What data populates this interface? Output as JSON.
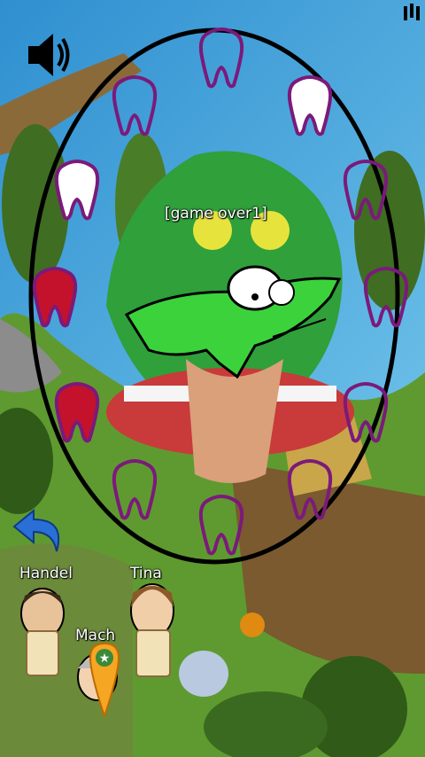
{
  "game": {
    "status_text": "[game over1]"
  },
  "players": [
    {
      "name": "Handel"
    },
    {
      "name": "Tina"
    },
    {
      "name": "Mach"
    }
  ],
  "teeth": [
    {
      "state": "empty",
      "outline": "#7b1a7b"
    },
    {
      "state": "empty",
      "outline": "#7b1a7b"
    },
    {
      "state": "white",
      "outline": "#7b1a7b"
    },
    {
      "state": "white",
      "outline": "#7b1a7b"
    },
    {
      "state": "empty",
      "outline": "#7b1a7b"
    },
    {
      "state": "red",
      "outline": "#7b1a7b"
    },
    {
      "state": "empty",
      "outline": "#7b1a7b"
    },
    {
      "state": "red",
      "outline": "#7b1a7b"
    },
    {
      "state": "empty",
      "outline": "#7b1a7b"
    },
    {
      "state": "empty",
      "outline": "#7b1a7b"
    },
    {
      "state": "empty",
      "outline": "#7b1a7b"
    },
    {
      "state": "empty",
      "outline": "#7b1a7b"
    }
  ],
  "colors": {
    "water": "#3f9ad0",
    "grass": "#5c8f2d",
    "field": "#8b6b3a",
    "crocodile": "#3cd23c",
    "tooth_red": "#c4122c",
    "ring": "#000000"
  },
  "icons": {
    "sound": "speaker-icon",
    "back": "back-arrow-icon",
    "menu": "menu-dots-icon",
    "location": "map-pin-star-icon"
  }
}
